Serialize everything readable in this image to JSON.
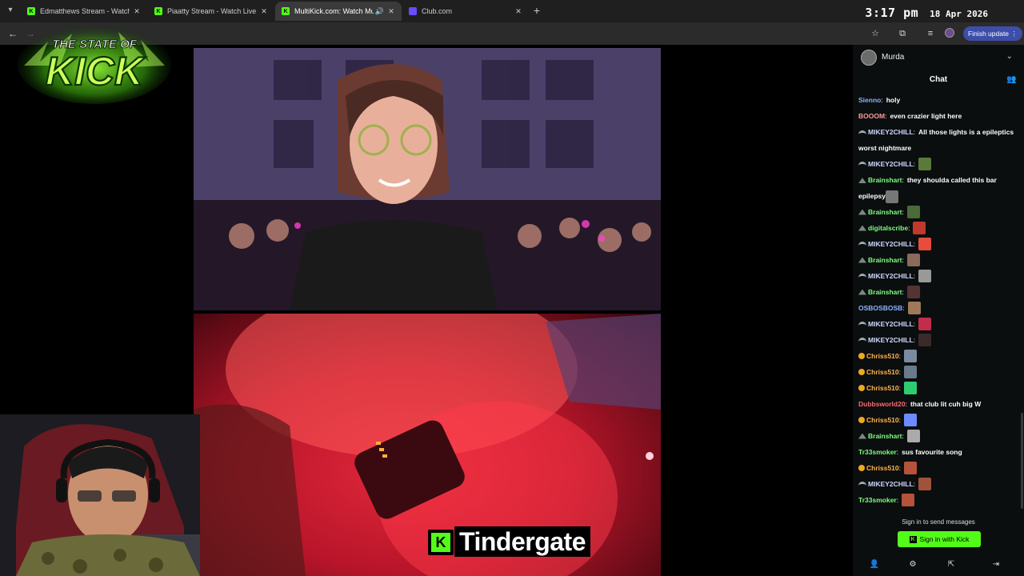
{
  "browser": {
    "tabs": [
      {
        "title": "Edmatthews Stream - Watch Live",
        "favicon": "kick-icon",
        "active": false
      },
      {
        "title": "Piaatty Stream - Watch Live on",
        "favicon": "kick-icon",
        "active": false
      },
      {
        "title": "MultiKick.com: Watch Multi",
        "favicon": "kick-icon",
        "active": true
      },
      {
        "title": "Club.com",
        "favicon": "club-icon",
        "active": false
      }
    ],
    "clock_time": "3:17 pm",
    "clock_date": "18 Apr 2026",
    "finish_update_label": "Finish update"
  },
  "logo": {
    "top": "THE STATE OF",
    "main": "KICK"
  },
  "caption": {
    "text": "Tindergate",
    "badge": "K"
  },
  "chat": {
    "user": "Murda",
    "title": "Chat",
    "messages": [
      {
        "badge": "",
        "name": "Sienno",
        "color": "#8ab4ff",
        "text": "holy",
        "emote": ""
      },
      {
        "badge": "",
        "name": "BOOOM",
        "color": "#ff9a9a",
        "text": "even crazier light here",
        "emote": ""
      },
      {
        "badge": "hat",
        "name": "MIKEY2CHILL",
        "color": "#cfd8ff",
        "text": "All those lights is a epileptics worst nightmare",
        "emote": "",
        "wrap": true
      },
      {
        "badge": "hat",
        "name": "MIKEY2CHILL",
        "color": "#cfd8ff",
        "text": "",
        "emote": "#5a7a3a"
      },
      {
        "badge": "sub",
        "name": "Brainshart",
        "color": "#7dff7d",
        "text": "they shoulda called this bar epilepsy",
        "emote": "#777777",
        "wrap": true
      },
      {
        "badge": "sub",
        "name": "Brainshart",
        "color": "#7dff7d",
        "text": "",
        "emote": "#4a6a3a"
      },
      {
        "badge": "sub",
        "name": "digitalscribe",
        "color": "#7dff7d",
        "text": "",
        "emote": "#c0392b"
      },
      {
        "badge": "hat",
        "name": "MIKEY2CHILL",
        "color": "#cfd8ff",
        "text": "",
        "emote": "#e74c3c"
      },
      {
        "badge": "sub",
        "name": "Brainshart",
        "color": "#7dff7d",
        "text": "",
        "emote": "#8a6a5a"
      },
      {
        "badge": "hat",
        "name": "MIKEY2CHILL",
        "color": "#cfd8ff",
        "text": "",
        "emote": "#999999"
      },
      {
        "badge": "sub",
        "name": "Brainshart",
        "color": "#7dff7d",
        "text": "",
        "emote": "#553333"
      },
      {
        "badge": "",
        "name": "OSBOSBOSB",
        "color": "#8ab4ff",
        "text": "",
        "emote": "#a0785a"
      },
      {
        "badge": "hat",
        "name": "MIKEY2CHILL",
        "color": "#cfd8ff",
        "text": "",
        "emote": "#c22e4a"
      },
      {
        "badge": "hat",
        "name": "MIKEY2CHILL",
        "color": "#cfd8ff",
        "text": "",
        "emote": "#3a2a2a"
      },
      {
        "badge": "coin",
        "name": "Chriss510",
        "color": "#ffb347",
        "text": "",
        "emote": "#7a8aa0"
      },
      {
        "badge": "coin",
        "name": "Chriss510",
        "color": "#ffb347",
        "text": "",
        "emote": "#6a7a8a"
      },
      {
        "badge": "coin",
        "name": "Chriss510",
        "color": "#ffb347",
        "text": "",
        "emote": "#2ecc71"
      },
      {
        "badge": "",
        "name": "Dubbsworld20",
        "color": "#ff6b6b",
        "text": "that club lit cuh big W",
        "emote": ""
      },
      {
        "badge": "coin",
        "name": "Chriss510",
        "color": "#ffb347",
        "text": "",
        "emote": "#6c8cff"
      },
      {
        "badge": "sub",
        "name": "Brainshart",
        "color": "#7dff7d",
        "text": "",
        "emote": "#aaaaaa"
      },
      {
        "badge": "",
        "name": "Tr33smoker",
        "color": "#7dff7d",
        "text": "sus favourite song",
        "emote": ""
      },
      {
        "badge": "coin",
        "name": "Chriss510",
        "color": "#ffb347",
        "text": "",
        "emote": "#b5523a"
      },
      {
        "badge": "hat",
        "name": "MIKEY2CHILL",
        "color": "#cfd8ff",
        "text": "",
        "emote": "#a0523a"
      },
      {
        "badge": "",
        "name": "Tr33smoker",
        "color": "#7dff7d",
        "text": "",
        "emote": "#b5523a"
      }
    ],
    "signin_note": "Sign in to send messages",
    "signin_button": "Sign in with Kick"
  },
  "colors": {
    "kick_green": "#53fc18",
    "finish_update_bg": "#3d4eaa"
  }
}
